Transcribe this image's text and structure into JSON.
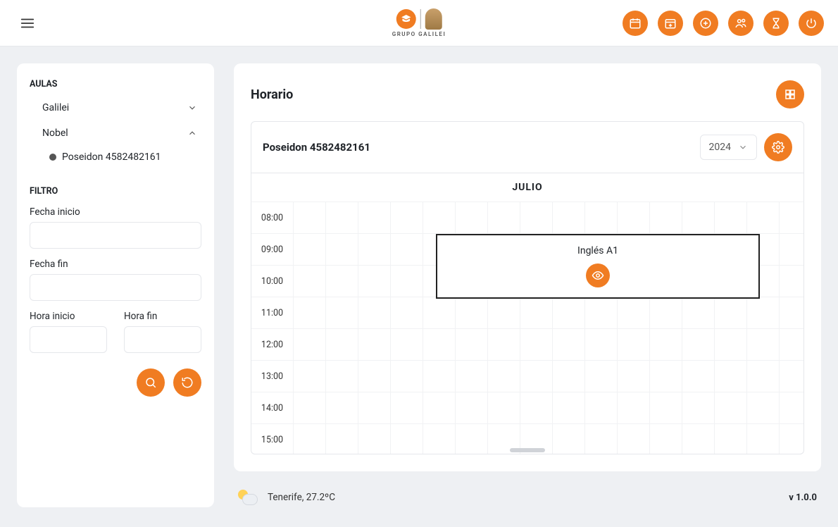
{
  "brand": {
    "text": "GRUPO GALILEI"
  },
  "topActions": [
    {
      "name": "calendar-icon"
    },
    {
      "name": "calendar-add-icon"
    },
    {
      "name": "plus-icon"
    },
    {
      "name": "users-icon"
    },
    {
      "name": "hourglass-icon"
    },
    {
      "name": "power-icon"
    }
  ],
  "sidebar": {
    "aulas_title": "AULAS",
    "tree": {
      "galilei": "Galilei",
      "nobel": "Nobel",
      "room": "Poseidon 4582482161"
    },
    "filtro_title": "FILTRO",
    "fecha_inicio_label": "Fecha inicio",
    "fecha_fin_label": "Fecha fin",
    "hora_inicio_label": "Hora inicio",
    "hora_fin_label": "Hora fin"
  },
  "main": {
    "title": "Horario",
    "room": "Poseidon 4582482161",
    "year": "2024",
    "month": "JULIO",
    "hours": [
      "08:00",
      "09:00",
      "10:00",
      "11:00",
      "12:00",
      "13:00",
      "14:00",
      "15:00"
    ],
    "event": {
      "title": "Inglés A1"
    }
  },
  "footer": {
    "weather": "Tenerife, 27.2ºC",
    "version": "v 1.0.0"
  }
}
